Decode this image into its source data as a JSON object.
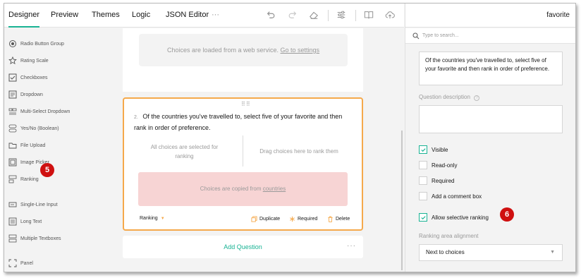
{
  "tabs": [
    {
      "label": "Designer",
      "active": true
    },
    {
      "label": "Preview"
    },
    {
      "label": "Themes"
    },
    {
      "label": "Logic"
    },
    {
      "label": "JSON Editor"
    }
  ],
  "tabs_more": "···",
  "toolbox": {
    "items": [
      {
        "label": "Radio Button Group",
        "icon": "radio-icon"
      },
      {
        "label": "Rating Scale",
        "icon": "star-icon"
      },
      {
        "label": "Checkboxes",
        "icon": "checkbox-icon"
      },
      {
        "label": "Dropdown",
        "icon": "dropdown-icon"
      },
      {
        "label": "Multi-Select Dropdown",
        "icon": "tagbox-icon"
      },
      {
        "label": "Yes/No (Boolean)",
        "icon": "boolean-icon"
      },
      {
        "label": "File Upload",
        "icon": "folder-icon"
      },
      {
        "label": "Image Picker",
        "icon": "image-icon"
      },
      {
        "label": "Ranking",
        "icon": "ranking-icon"
      },
      {
        "label": "Single-Line Input",
        "icon": "input-icon"
      },
      {
        "label": "Long Text",
        "icon": "textarea-icon"
      },
      {
        "label": "Multiple Textboxes",
        "icon": "multitext-icon"
      },
      {
        "label": "Panel",
        "icon": "panel-icon"
      }
    ]
  },
  "badges": {
    "left": "5",
    "right": "6"
  },
  "canvas": {
    "webservice_text": "Choices are loaded from a web service.",
    "webservice_link": "Go to settings",
    "question": {
      "number": "2.",
      "title": "Of the countries you've travelled to, select five of your favorite and then rank in order of preference.",
      "left_hint": "All choices are selected for ranking",
      "right_hint": "Drag choices here to rank them",
      "copied_text": "Choices are copied from",
      "copied_link": "countries",
      "type_label": "Ranking",
      "duplicate": "Duplicate",
      "required": "Required",
      "delete": "Delete"
    },
    "add_question": "Add Question"
  },
  "props": {
    "title": "favorite",
    "search_placeholder": "Type to search...",
    "question_title_value": "Of the countries you've travelled to, select five of your favorite and then rank in order of preference.",
    "description_label": "Question description",
    "checkboxes": [
      {
        "label": "Visible",
        "checked": true
      },
      {
        "label": "Read-only",
        "checked": false
      },
      {
        "label": "Required",
        "checked": false
      },
      {
        "label": "Add a comment box",
        "checked": false
      },
      {
        "label": "Allow selective ranking",
        "checked": true
      }
    ],
    "alignment_label": "Ranking area alignment",
    "alignment_value": "Next to choices"
  },
  "colors": {
    "accent": "#19b394",
    "selected_border": "#f5a94b",
    "badge": "#cf1010",
    "copied_bg": "#f7d4d4"
  }
}
